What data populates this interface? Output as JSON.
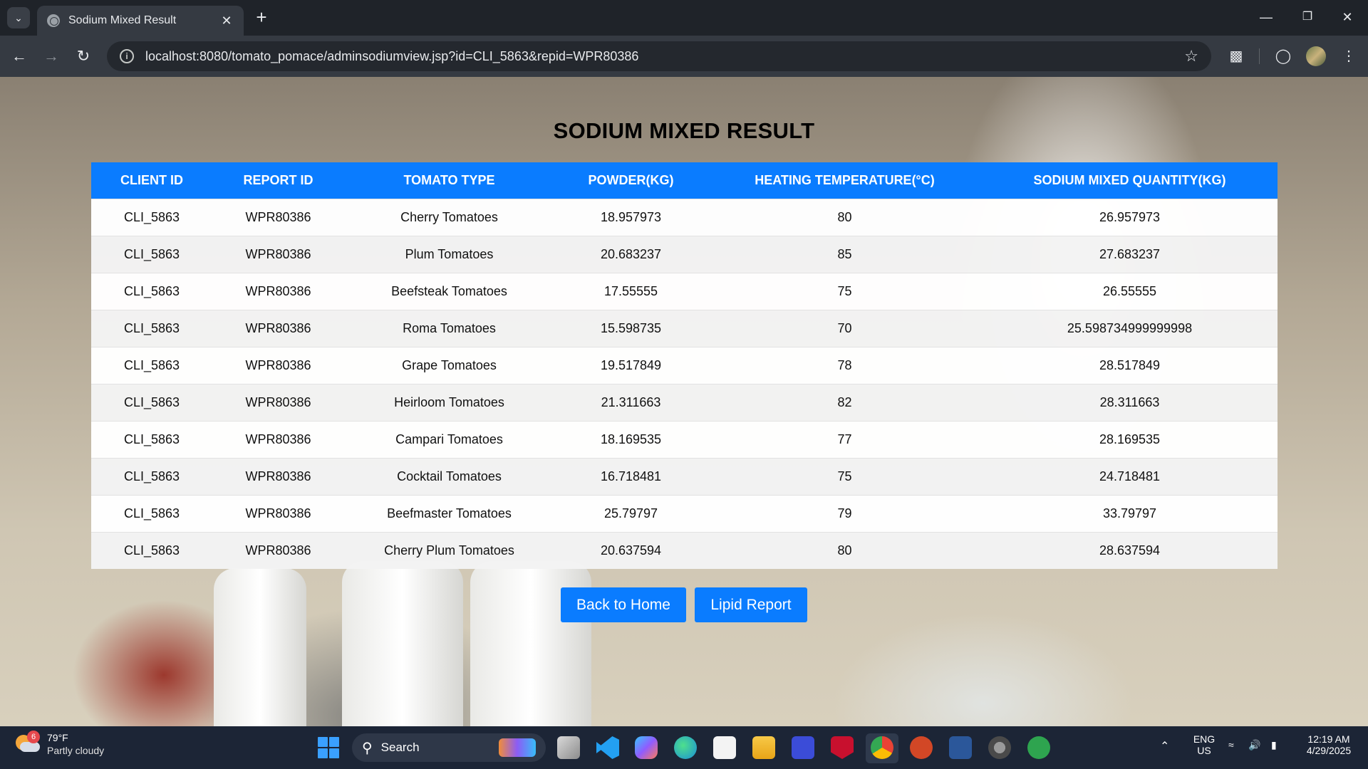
{
  "browser": {
    "tab_title": "Sodium Mixed Result",
    "url": "localhost:8080/tomato_pomace/adminsodiumview.jsp?id=CLI_5863&repid=WPR80386"
  },
  "page": {
    "title": "SODIUM MIXED RESULT",
    "table": {
      "headers": [
        "CLIENT ID",
        "REPORT ID",
        "TOMATO TYPE",
        "POWDER(KG)",
        "HEATING TEMPERATURE(°C)",
        "SODIUM MIXED QUANTITY(KG)"
      ],
      "rows": [
        [
          "CLI_5863",
          "WPR80386",
          "Cherry Tomatoes",
          "18.957973",
          "80",
          "26.957973"
        ],
        [
          "CLI_5863",
          "WPR80386",
          "Plum Tomatoes",
          "20.683237",
          "85",
          "27.683237"
        ],
        [
          "CLI_5863",
          "WPR80386",
          "Beefsteak Tomatoes",
          "17.55555",
          "75",
          "26.55555"
        ],
        [
          "CLI_5863",
          "WPR80386",
          "Roma Tomatoes",
          "15.598735",
          "70",
          "25.598734999999998"
        ],
        [
          "CLI_5863",
          "WPR80386",
          "Grape Tomatoes",
          "19.517849",
          "78",
          "28.517849"
        ],
        [
          "CLI_5863",
          "WPR80386",
          "Heirloom Tomatoes",
          "21.311663",
          "82",
          "28.311663"
        ],
        [
          "CLI_5863",
          "WPR80386",
          "Campari Tomatoes",
          "18.169535",
          "77",
          "28.169535"
        ],
        [
          "CLI_5863",
          "WPR80386",
          "Cocktail Tomatoes",
          "16.718481",
          "75",
          "24.718481"
        ],
        [
          "CLI_5863",
          "WPR80386",
          "Beefmaster Tomatoes",
          "25.79797",
          "79",
          "33.79797"
        ],
        [
          "CLI_5863",
          "WPR80386",
          "Cherry Plum Tomatoes",
          "20.637594",
          "80",
          "28.637594"
        ]
      ]
    },
    "buttons": {
      "back_home": "Back to Home",
      "lipid_report": "Lipid Report"
    }
  },
  "taskbar": {
    "weather_temp": "79°F",
    "weather_desc": "Partly cloudy",
    "weather_badge": "6",
    "search_label": "Search",
    "lang_top": "ENG",
    "lang_bottom": "US",
    "time": "12:19 AM",
    "date": "4/29/2025"
  },
  "colors": {
    "accent": "#0a7cff",
    "chrome_dark": "#1f2329",
    "chrome_toolbar": "#353a42",
    "taskbar": "#1c2536"
  }
}
